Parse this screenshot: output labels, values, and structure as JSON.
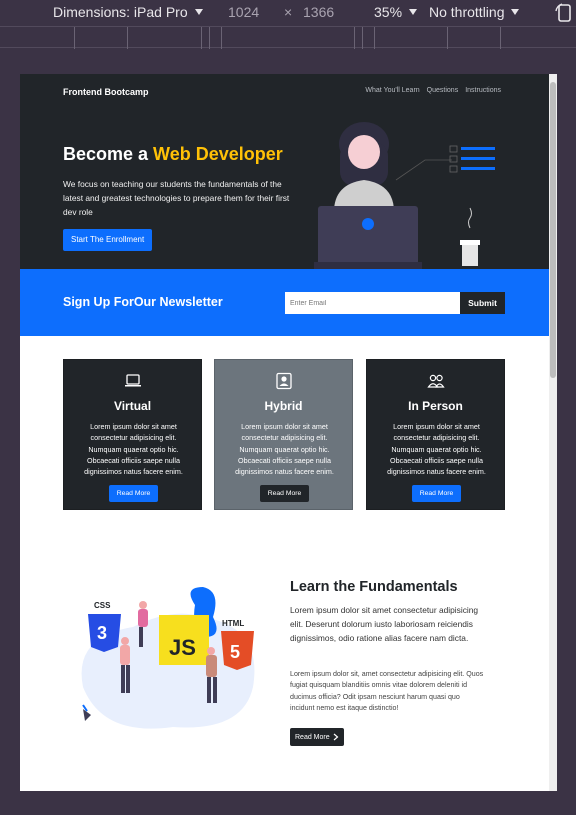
{
  "devtools": {
    "dimensions_label": "Dimensions: iPad Pro",
    "width": "1024",
    "times": "×",
    "height": "1366",
    "zoom": "35%",
    "throttling": "No throttling"
  },
  "navbar": {
    "brand": "Frontend Bootcamp",
    "links": [
      "What You'll Learn",
      "Questions",
      "Instructions"
    ]
  },
  "hero": {
    "title_prefix": "Become a ",
    "title_accent": "Web Developer",
    "description": "We focus on teaching our students the fundamentals of the latest and greatest technologies to prepare them for their first dev role",
    "cta": "Start The Enrollment"
  },
  "newsletter": {
    "title": "Sign Up ForOur Newsletter",
    "email_placeholder": "Enter Email",
    "submit": "Submit"
  },
  "cards": [
    {
      "title": "Virtual",
      "text": "Lorem ipsum dolor sit amet consectetur adipisicing elit. Numquam quaerat optio hic. Obcaecati officiis saepe nulla dignissimos natus facere enim.",
      "button": "Read More",
      "icon": "laptop-icon"
    },
    {
      "title": "Hybrid",
      "text": "Lorem ipsum dolor sit amet consectetur adipisicing elit. Numquam quaerat optio hic. Obcaecati officiis saepe nulla dignissimos natus facere enim.",
      "button": "Read More",
      "icon": "person-badge-icon"
    },
    {
      "title": "In Person",
      "text": "Lorem ipsum dolor sit amet consectetur adipisicing elit. Numquam quaerat optio hic. Obcaecati officiis saepe nulla dignissimos natus facere enim.",
      "button": "Read More",
      "icon": "people-icon"
    }
  ],
  "learn": {
    "title": "Learn the Fundamentals",
    "lead": "Lorem ipsum dolor sit amet consectetur adipisicing elit. Deserunt dolorum iusto laboriosam reiciendis dignissimos, odio ratione alias facere nam dicta.",
    "body": "Lorem ipsum dolor sit, amet consectetur adipisicing elit. Quos fugiat quisquam blanditiis omnis vitae dolorem deleniti id ducimus officia? Odit ipsam nesciunt harum quasi quo incidunt nemo est itaque distinctio!",
    "button": "Read More",
    "illustration_labels": {
      "css": "CSS",
      "js": "JS",
      "html": "HTML"
    }
  },
  "colors": {
    "dark": "#212529",
    "primary": "#0d6efd",
    "warning": "#ffc107",
    "secondary": "#6c757d"
  }
}
